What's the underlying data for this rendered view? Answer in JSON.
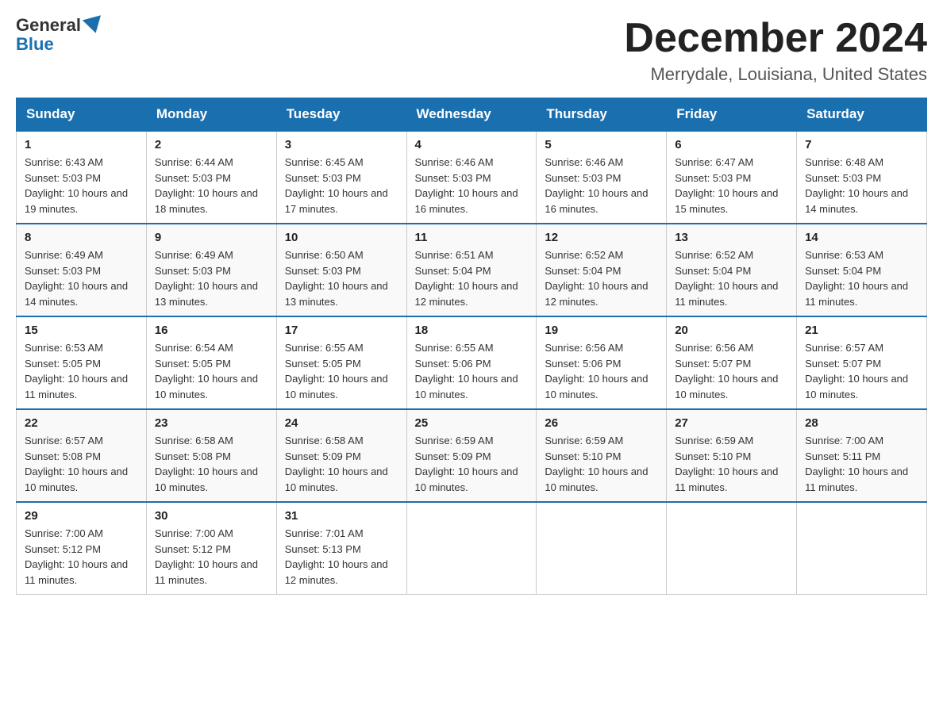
{
  "logo": {
    "general": "General",
    "blue": "Blue"
  },
  "header": {
    "month": "December 2024",
    "location": "Merrydale, Louisiana, United States"
  },
  "days_of_week": [
    "Sunday",
    "Monday",
    "Tuesday",
    "Wednesday",
    "Thursday",
    "Friday",
    "Saturday"
  ],
  "weeks": [
    [
      {
        "day": "1",
        "sunrise": "6:43 AM",
        "sunset": "5:03 PM",
        "daylight": "10 hours and 19 minutes."
      },
      {
        "day": "2",
        "sunrise": "6:44 AM",
        "sunset": "5:03 PM",
        "daylight": "10 hours and 18 minutes."
      },
      {
        "day": "3",
        "sunrise": "6:45 AM",
        "sunset": "5:03 PM",
        "daylight": "10 hours and 17 minutes."
      },
      {
        "day": "4",
        "sunrise": "6:46 AM",
        "sunset": "5:03 PM",
        "daylight": "10 hours and 16 minutes."
      },
      {
        "day": "5",
        "sunrise": "6:46 AM",
        "sunset": "5:03 PM",
        "daylight": "10 hours and 16 minutes."
      },
      {
        "day": "6",
        "sunrise": "6:47 AM",
        "sunset": "5:03 PM",
        "daylight": "10 hours and 15 minutes."
      },
      {
        "day": "7",
        "sunrise": "6:48 AM",
        "sunset": "5:03 PM",
        "daylight": "10 hours and 14 minutes."
      }
    ],
    [
      {
        "day": "8",
        "sunrise": "6:49 AM",
        "sunset": "5:03 PM",
        "daylight": "10 hours and 14 minutes."
      },
      {
        "day": "9",
        "sunrise": "6:49 AM",
        "sunset": "5:03 PM",
        "daylight": "10 hours and 13 minutes."
      },
      {
        "day": "10",
        "sunrise": "6:50 AM",
        "sunset": "5:03 PM",
        "daylight": "10 hours and 13 minutes."
      },
      {
        "day": "11",
        "sunrise": "6:51 AM",
        "sunset": "5:04 PM",
        "daylight": "10 hours and 12 minutes."
      },
      {
        "day": "12",
        "sunrise": "6:52 AM",
        "sunset": "5:04 PM",
        "daylight": "10 hours and 12 minutes."
      },
      {
        "day": "13",
        "sunrise": "6:52 AM",
        "sunset": "5:04 PM",
        "daylight": "10 hours and 11 minutes."
      },
      {
        "day": "14",
        "sunrise": "6:53 AM",
        "sunset": "5:04 PM",
        "daylight": "10 hours and 11 minutes."
      }
    ],
    [
      {
        "day": "15",
        "sunrise": "6:53 AM",
        "sunset": "5:05 PM",
        "daylight": "10 hours and 11 minutes."
      },
      {
        "day": "16",
        "sunrise": "6:54 AM",
        "sunset": "5:05 PM",
        "daylight": "10 hours and 10 minutes."
      },
      {
        "day": "17",
        "sunrise": "6:55 AM",
        "sunset": "5:05 PM",
        "daylight": "10 hours and 10 minutes."
      },
      {
        "day": "18",
        "sunrise": "6:55 AM",
        "sunset": "5:06 PM",
        "daylight": "10 hours and 10 minutes."
      },
      {
        "day": "19",
        "sunrise": "6:56 AM",
        "sunset": "5:06 PM",
        "daylight": "10 hours and 10 minutes."
      },
      {
        "day": "20",
        "sunrise": "6:56 AM",
        "sunset": "5:07 PM",
        "daylight": "10 hours and 10 minutes."
      },
      {
        "day": "21",
        "sunrise": "6:57 AM",
        "sunset": "5:07 PM",
        "daylight": "10 hours and 10 minutes."
      }
    ],
    [
      {
        "day": "22",
        "sunrise": "6:57 AM",
        "sunset": "5:08 PM",
        "daylight": "10 hours and 10 minutes."
      },
      {
        "day": "23",
        "sunrise": "6:58 AM",
        "sunset": "5:08 PM",
        "daylight": "10 hours and 10 minutes."
      },
      {
        "day": "24",
        "sunrise": "6:58 AM",
        "sunset": "5:09 PM",
        "daylight": "10 hours and 10 minutes."
      },
      {
        "day": "25",
        "sunrise": "6:59 AM",
        "sunset": "5:09 PM",
        "daylight": "10 hours and 10 minutes."
      },
      {
        "day": "26",
        "sunrise": "6:59 AM",
        "sunset": "5:10 PM",
        "daylight": "10 hours and 10 minutes."
      },
      {
        "day": "27",
        "sunrise": "6:59 AM",
        "sunset": "5:10 PM",
        "daylight": "10 hours and 11 minutes."
      },
      {
        "day": "28",
        "sunrise": "7:00 AM",
        "sunset": "5:11 PM",
        "daylight": "10 hours and 11 minutes."
      }
    ],
    [
      {
        "day": "29",
        "sunrise": "7:00 AM",
        "sunset": "5:12 PM",
        "daylight": "10 hours and 11 minutes."
      },
      {
        "day": "30",
        "sunrise": "7:00 AM",
        "sunset": "5:12 PM",
        "daylight": "10 hours and 11 minutes."
      },
      {
        "day": "31",
        "sunrise": "7:01 AM",
        "sunset": "5:13 PM",
        "daylight": "10 hours and 12 minutes."
      },
      null,
      null,
      null,
      null
    ]
  ],
  "labels": {
    "sunrise": "Sunrise:",
    "sunset": "Sunset:",
    "daylight": "Daylight:"
  }
}
